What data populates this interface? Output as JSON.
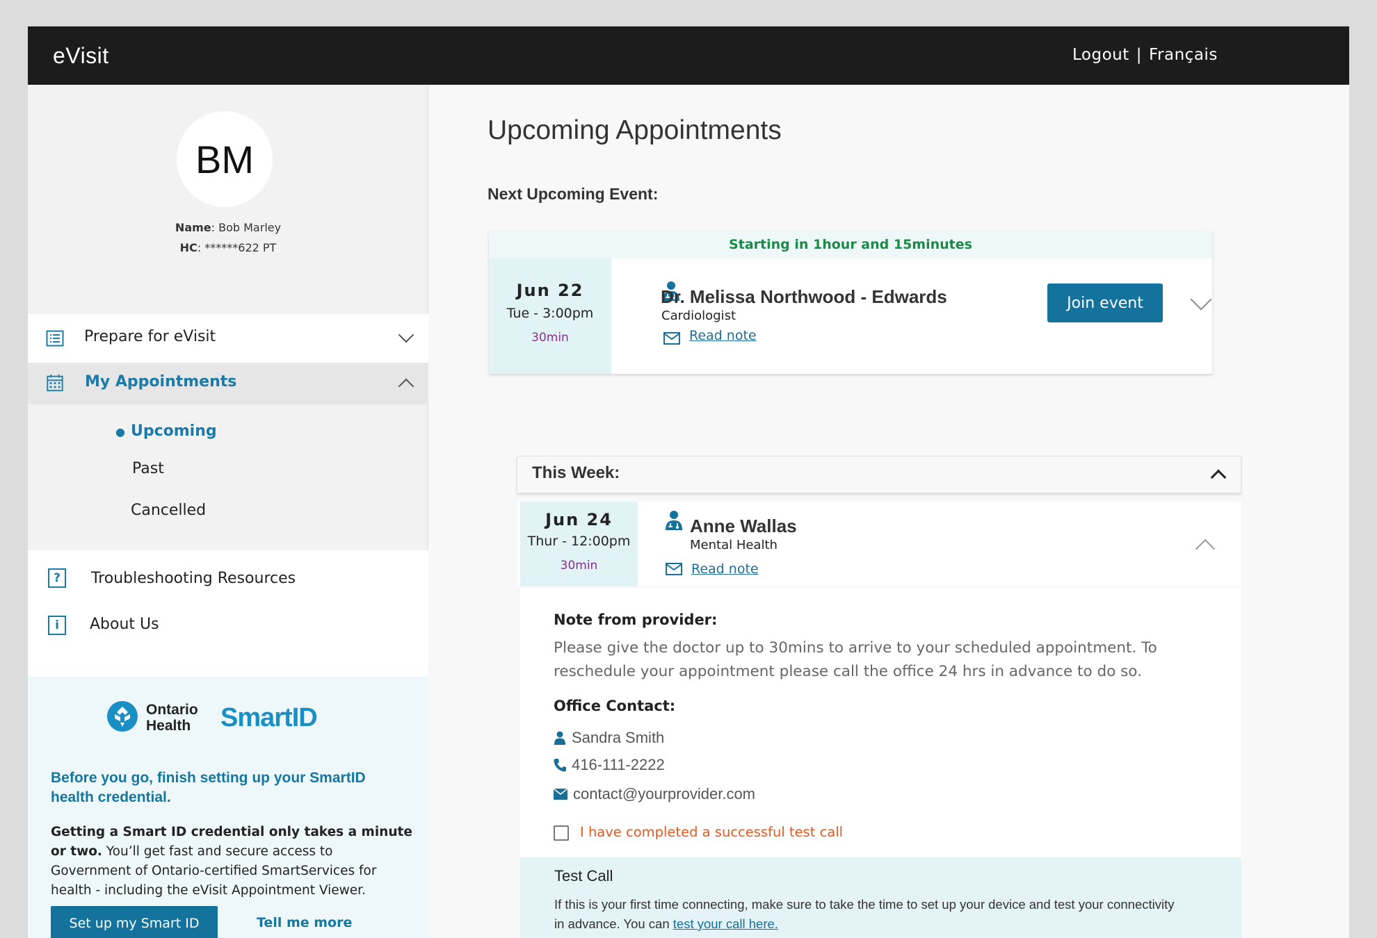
{
  "header": {
    "brand": "eVisit",
    "logout": "Logout",
    "separator": "|",
    "language": "Français"
  },
  "profile": {
    "initials": "BM",
    "name_label": "Name",
    "name_value": ": Bob Marley",
    "hc_label": "HC",
    "hc_value": ": ******622 PT"
  },
  "sidebar": {
    "prepare": "Prepare for eVisit",
    "appointments": "My Appointments",
    "sub": {
      "upcoming": "Upcoming",
      "past": "Past",
      "cancelled": "Cancelled"
    },
    "troubleshooting": "Troubleshooting Resources",
    "about": "About Us"
  },
  "promo": {
    "logo_line1": "Ontario",
    "logo_line2": "Health",
    "logo_smartid": "SmartID",
    "headline": "Before you go, finish setting up your SmartID health credential.",
    "body_bold": "Getting a Smart ID credential only takes a minute or two.",
    "body_rest": " You’ll get fast and secure access to Government of Ontario-certified SmartServices for health - including the eVisit Appointment Viewer.",
    "setup_button": "Set up my Smart ID",
    "tell_more": "Tell me more"
  },
  "main": {
    "title": "Upcoming Appointments",
    "next_label": "Next Upcoming Event:",
    "next_event": {
      "banner": "Starting in 1hour and 15minutes",
      "date": "Jun 22",
      "day_time": "Tue - 3:00pm",
      "duration": "30min",
      "doctor": "Dr. Melissa Northwood - Edwards",
      "specialty": "Cardiologist",
      "read_note": "Read note",
      "join": "Join event"
    },
    "this_week_label": "This Week:",
    "week_event": {
      "date": "Jun 24",
      "day_time": "Thur - 12:00pm",
      "duration": "30min",
      "doctor": "Anne Wallas",
      "specialty": "Mental Health",
      "read_note": "Read note"
    },
    "detail": {
      "note_label": "Note from provider:",
      "note_text": "Please give the doctor up to 30mins to arrive to your scheduled appointment. To reschedule your appointment please call the office 24 hrs in advance to do so.",
      "office_label": "Office Contact:",
      "contact_name": "Sandra Smith",
      "contact_phone": "416-111-2222",
      "contact_email": "contact@yourprovider.com",
      "checkbox_label": "I have completed a successful test call",
      "test_title": "Test Call",
      "test_body": "If this is your first time connecting, make sure to take the time to set up your device and test your connectivity in advance. You can ",
      "test_link": "test your call here."
    }
  },
  "colors": {
    "accent": "#13739d",
    "success": "#1b8a46",
    "warning": "#e15a1f",
    "duration": "#8c2c95"
  }
}
